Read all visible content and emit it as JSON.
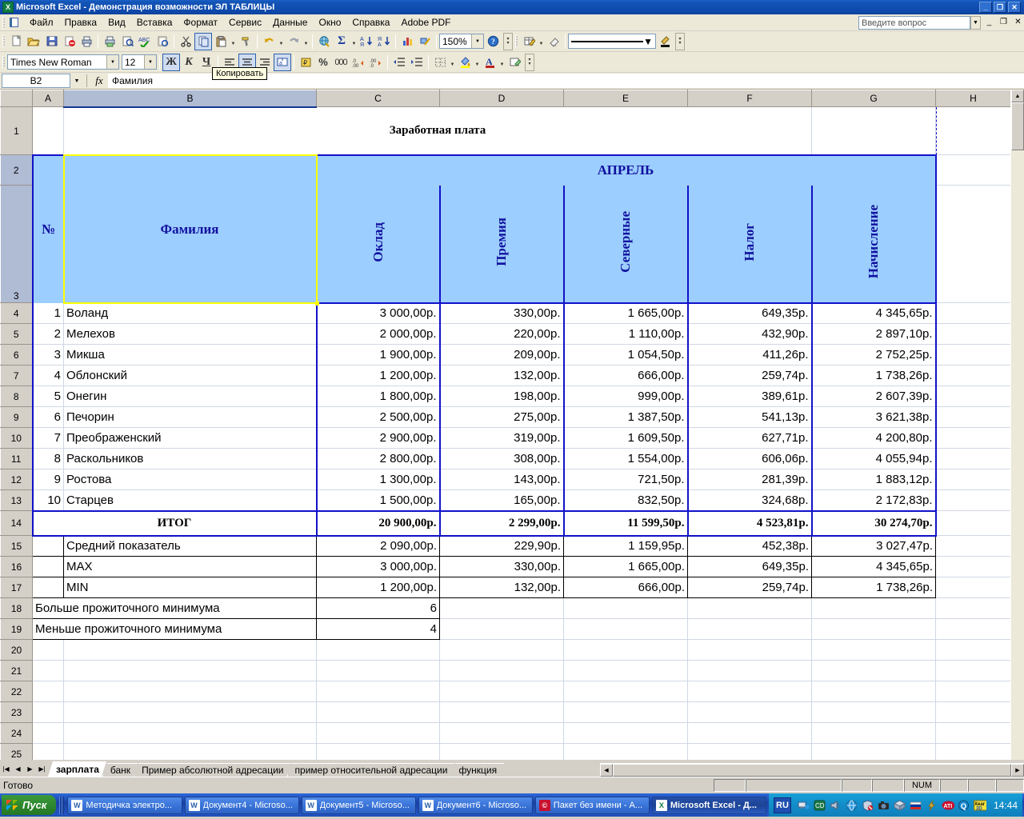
{
  "window": {
    "title": "Microsoft Excel - Демонстрация возможности ЭЛ ТАБЛИЦЫ",
    "app_icon": "excel-icon",
    "minimize": "_",
    "restore": "❐",
    "close": "✕"
  },
  "menu": {
    "items": [
      "Файл",
      "Правка",
      "Вид",
      "Вставка",
      "Формат",
      "Сервис",
      "Данные",
      "Окно",
      "Справка",
      "Adobe PDF"
    ],
    "ask_placeholder": "Введите вопрос",
    "doc_min": "_",
    "doc_restore": "❐",
    "doc_close": "✕"
  },
  "toolbar_standard": {
    "zoom": "150%",
    "buttons": [
      "new-icon",
      "open-icon",
      "save-icon",
      "permission-icon",
      "print-icon",
      "print2-icon",
      "print-preview-icon",
      "spelling-icon",
      "research-icon",
      "cut-icon",
      "copy-icon",
      "paste-icon",
      "format-painter-icon",
      "undo-icon",
      "redo-icon",
      "hyperlink-icon",
      "autosum-icon",
      "sort-asc-icon",
      "sort-desc-icon",
      "chart-icon",
      "drawing-icon",
      "help-icon"
    ],
    "tooltip": "Копировать"
  },
  "toolbar_formatting": {
    "font_name": "Times New Roman",
    "font_size": "12",
    "bold": "Ж",
    "italic": "К",
    "underline": "Ч",
    "buttons": [
      "align-left-icon",
      "align-center-icon",
      "align-right-icon",
      "merge-center-icon",
      "currency-icon",
      "percent-icon",
      "comma-icon",
      "increase-decimal-icon",
      "decrease-decimal-icon",
      "decrease-indent-icon",
      "increase-indent-icon",
      "borders-icon",
      "fill-color-icon",
      "font-color-icon",
      "settings-icon"
    ]
  },
  "toolbar_extra": {
    "buttons": [
      "edit-table-icon",
      "eraser-icon",
      "line-style-icon",
      "border-color-icon"
    ]
  },
  "formula_bar": {
    "name_box": "B2",
    "fx": "fx",
    "value": "Фамилия"
  },
  "grid": {
    "columns": [
      "A",
      "B",
      "C",
      "D",
      "E",
      "F",
      "G",
      "H"
    ],
    "selected_column": "B",
    "rows": [
      "1",
      "2",
      "3",
      "4",
      "5",
      "6",
      "7",
      "8",
      "9",
      "10",
      "11",
      "12",
      "13",
      "14",
      "15",
      "16",
      "17",
      "18",
      "19",
      "20",
      "21",
      "22",
      "23",
      "24",
      "25"
    ],
    "selected_rows": [
      "2",
      "3"
    ]
  },
  "sheet": {
    "title": "Заработная плата",
    "month_header": "АПРЕЛЬ",
    "col_no": "№",
    "col_surname": "Фамилия",
    "col_headers": [
      "Оклад",
      "Премия",
      "Северные",
      "Налог",
      "Начисление"
    ],
    "total_label": "ИТОГ",
    "data": [
      {
        "no": "1",
        "name": "Воланд",
        "oklad": "3 000,00р.",
        "premiya": "330,00р.",
        "severnye": "1 665,00р.",
        "nalog": "649,35р.",
        "nachislenie": "4 345,65р."
      },
      {
        "no": "2",
        "name": "Мелехов",
        "oklad": "2 000,00р.",
        "premiya": "220,00р.",
        "severnye": "1 110,00р.",
        "nalog": "432,90р.",
        "nachislenie": "2 897,10р."
      },
      {
        "no": "3",
        "name": "Микша",
        "oklad": "1 900,00р.",
        "premiya": "209,00р.",
        "severnye": "1 054,50р.",
        "nalog": "411,26р.",
        "nachislenie": "2 752,25р."
      },
      {
        "no": "4",
        "name": "Облонский",
        "oklad": "1 200,00р.",
        "premiya": "132,00р.",
        "severnye": "666,00р.",
        "nalog": "259,74р.",
        "nachislenie": "1 738,26р."
      },
      {
        "no": "5",
        "name": "Онегин",
        "oklad": "1 800,00р.",
        "premiya": "198,00р.",
        "severnye": "999,00р.",
        "nalog": "389,61р.",
        "nachislenie": "2 607,39р."
      },
      {
        "no": "6",
        "name": "Печорин",
        "oklad": "2 500,00р.",
        "premiya": "275,00р.",
        "severnye": "1 387,50р.",
        "nalog": "541,13р.",
        "nachislenie": "3 621,38р."
      },
      {
        "no": "7",
        "name": "Преображенский",
        "oklad": "2 900,00р.",
        "premiya": "319,00р.",
        "severnye": "1 609,50р.",
        "nalog": "627,71р.",
        "nachislenie": "4 200,80р."
      },
      {
        "no": "8",
        "name": "Раскольников",
        "oklad": "2 800,00р.",
        "premiya": "308,00р.",
        "severnye": "1 554,00р.",
        "nalog": "606,06р.",
        "nachislenie": "4 055,94р."
      },
      {
        "no": "9",
        "name": "Ростова",
        "oklad": "1 300,00р.",
        "premiya": "143,00р.",
        "severnye": "721,50р.",
        "nalog": "281,39р.",
        "nachislenie": "1 883,12р."
      },
      {
        "no": "10",
        "name": "Старцев",
        "oklad": "1 500,00р.",
        "premiya": "165,00р.",
        "severnye": "832,50р.",
        "nalog": "324,68р.",
        "nachislenie": "2 172,83р."
      }
    ],
    "total": {
      "oklad": "20 900,00р.",
      "premiya": "2 299,00р.",
      "severnye": "11 599,50р.",
      "nalog": "4 523,81р.",
      "nachislenie": "30 274,70р."
    },
    "stats": [
      {
        "label": "Средний показатель",
        "oklad": "2 090,00р.",
        "premiya": "229,90р.",
        "severnye": "1 159,95р.",
        "nalog": "452,38р.",
        "nachislenie": "3 027,47р."
      },
      {
        "label": "MAX",
        "oklad": "3 000,00р.",
        "premiya": "330,00р.",
        "severnye": "1 665,00р.",
        "nalog": "649,35р.",
        "nachislenie": "4 345,65р."
      },
      {
        "label": "MIN",
        "oklad": "1 200,00р.",
        "premiya": "132,00р.",
        "severnye": "666,00р.",
        "nalog": "259,74р.",
        "nachislenie": "1 738,26р."
      }
    ],
    "counts": [
      {
        "label": "Больше прожиточного минимума",
        "value": "6"
      },
      {
        "label": "Меньше прожиточного минимума",
        "value": "4"
      }
    ]
  },
  "sheet_tabs": {
    "tabs": [
      "зарплата",
      "банк",
      "Пример абсолютной адресации",
      "пример относительной адресации",
      "функция"
    ],
    "active": "зарплата",
    "nav_first": "|◀",
    "nav_prev": "◀",
    "nav_next": "▶",
    "nav_last": "▶|"
  },
  "status_bar": {
    "message": "Готово",
    "num_lock": "NUM"
  },
  "taskbar": {
    "start": "Пуск",
    "buttons": [
      {
        "label": "Методичка электро...",
        "icon": "word-icon",
        "active": false
      },
      {
        "label": "Документ4 - Microso...",
        "icon": "word-icon",
        "active": false
      },
      {
        "label": "Документ5 - Microso...",
        "icon": "word-icon",
        "active": false
      },
      {
        "label": "Документ6 - Microso...",
        "icon": "word-icon",
        "active": false
      },
      {
        "label": "Пакет без имени - А...",
        "icon": "acdsee-icon",
        "active": false
      },
      {
        "label": "Microsoft Excel - Д...",
        "icon": "excel-icon",
        "active": true
      }
    ],
    "language": "RU",
    "tray_icons": [
      "network-icon",
      "cd-icon",
      "volume-icon",
      "globe-icon",
      "security-icon",
      "camera-icon",
      "package-icon",
      "flag-icon",
      "lightning-icon",
      "ati-icon",
      "qip-icon",
      "xear3d-icon"
    ],
    "clock": "14:44"
  },
  "colors": {
    "title_blue": "#0d47a8",
    "header_fill": "#9cceff",
    "header_text": "#11119e",
    "selection_fill": "#b2b9cc",
    "selection_border": "#ffff00",
    "table_border": "#1111c8"
  }
}
